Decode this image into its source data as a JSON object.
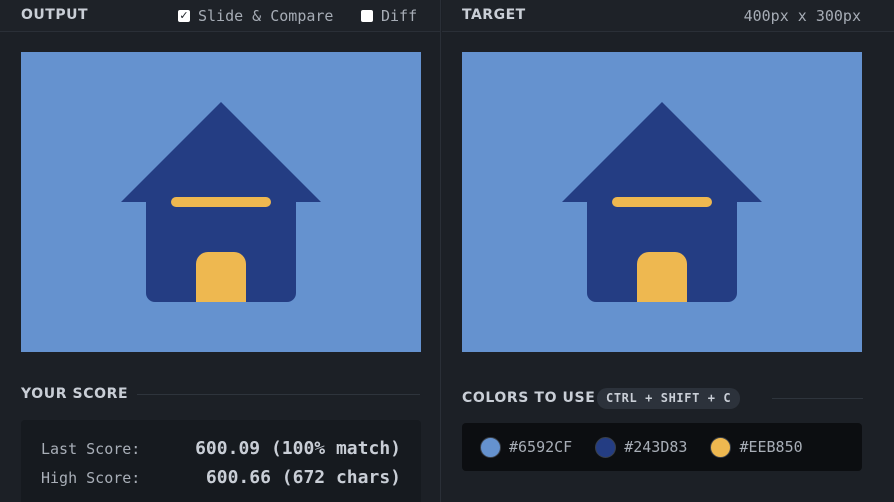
{
  "output_panel": {
    "title": "OUTPUT",
    "slide_compare_label": "Slide & Compare",
    "slide_compare_checked": true,
    "diff_label": "Diff",
    "diff_checked": false
  },
  "target_panel": {
    "title": "TARGET",
    "dimensions": "400px x 300px"
  },
  "score": {
    "title": "YOUR SCORE",
    "last_label": "Last Score:",
    "last_value": "600.09 (100% match)",
    "high_label": "High Score:",
    "high_value": "600.66 (672 chars)"
  },
  "colors": {
    "title": "COLORS TO USE",
    "shortcut": "CTRL + SHIFT + C",
    "swatches": [
      {
        "label": "#6592CF",
        "hex": "#6592CF"
      },
      {
        "label": "#243D83",
        "hex": "#243D83"
      },
      {
        "label": "#EEB850",
        "hex": "#EEB850"
      }
    ]
  },
  "icons": {
    "slide_compare_checkbox": "check-icon",
    "diff_checkbox": "empty-checkbox-icon"
  }
}
